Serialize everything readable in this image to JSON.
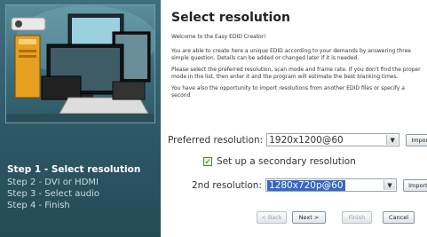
{
  "sidebar": {
    "steps": [
      {
        "label": "Step 1 - Select resolution",
        "active": true
      },
      {
        "label": "Step 2 - DVI or HDMI",
        "active": false
      },
      {
        "label": "Step 3 - Select audio",
        "active": false
      },
      {
        "label": "Step 4 - Finish",
        "active": false
      }
    ]
  },
  "main": {
    "title": "Select resolution",
    "paragraphs": [
      "Welcome to the Easy EDID Creator!",
      "You are able to create here a unique EDID according to your demands by answering three simple question. Details can be added or changed later if it is needed.",
      "Please select the preferred resolution, scan mode and frame rate. If you don't find the proper mode in the list, then enter it and the program will estimate the best blanking times.",
      "You have also the opportunity to import resolutions from another EDID files or specify a second"
    ],
    "preferred": {
      "label": "Preferred resolution:",
      "value": "1920x1200@60",
      "import_label": "Import..."
    },
    "secondary_checkbox": {
      "label": "Set up a secondary resolution",
      "checked": true
    },
    "second": {
      "label": "2nd resolution:",
      "value": "1280x720p@60",
      "import_label": "Import..."
    }
  },
  "footer": {
    "back_label": "< Back",
    "next_label": "Next >",
    "finish_label": "Finish",
    "cancel_label": "Cancel"
  }
}
